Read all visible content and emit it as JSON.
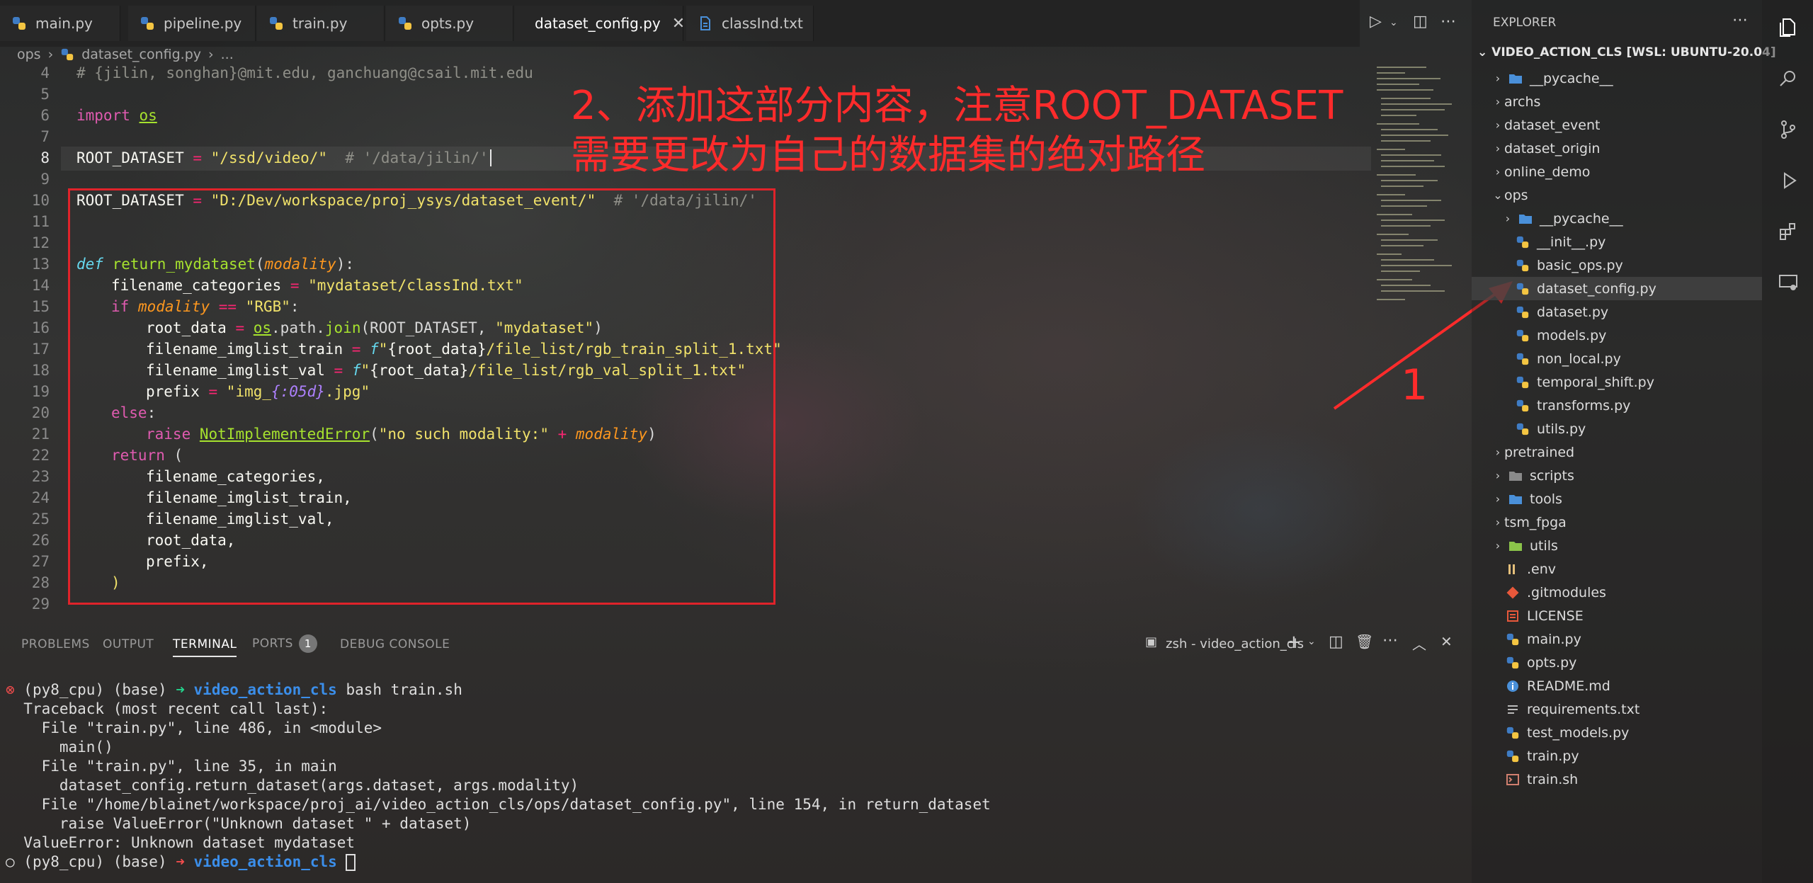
{
  "tabs": [
    {
      "label": "main.py",
      "icon": "python-icon"
    },
    {
      "label": "pipeline.py",
      "icon": "python-icon"
    },
    {
      "label": "train.py",
      "icon": "python-icon"
    },
    {
      "label": "opts.py",
      "icon": "python-icon"
    },
    {
      "label": "dataset_config.py",
      "icon": "python-icon",
      "active": true
    },
    {
      "label": "classInd.txt",
      "icon": "text-file-icon"
    }
  ],
  "breadcrumb": {
    "folder": "ops",
    "file": "dataset_config.py",
    "more": "..."
  },
  "editor": {
    "line_numbers": [
      "4",
      "5",
      "6",
      "7",
      "8",
      "9",
      "10",
      "11",
      "12",
      "13",
      "14",
      "15",
      "16",
      "17",
      "18",
      "19",
      "20",
      "21",
      "22",
      "23",
      "24",
      "25",
      "26",
      "27",
      "28",
      "29"
    ],
    "code": {
      "l4": "# {jilin, songhan}@mit.edu, ganchuang@csail.mit.edu",
      "l6_kw": "import",
      "l6_mod": "os",
      "l8_var": "ROOT_DATASET",
      "l8_eq": " = ",
      "l8_str": "\"/ssd/video/\"",
      "l8_cm": "  # '/data/jilin/'",
      "l10_var": "ROOT_DATASET",
      "l10_eq": " = ",
      "l10_str": "\"D:/Dev/workspace/proj_ysys/dataset_event/\"",
      "l10_cm": "  # '/data/jilin/'",
      "l13_kw": "def",
      "l13_fn": "return_mydataset",
      "l13_open": "(",
      "l13_pm": "modality",
      "l13_close": "):",
      "l14_var": "filename_categories",
      "l14_eq": " = ",
      "l14_str": "\"mydataset/classInd.txt\"",
      "l15_kw": "if",
      "l15_pm": "modality",
      "l15_op": " == ",
      "l15_str": "\"RGB\"",
      "l15_end": ":",
      "l16_var": "root_data",
      "l16_eq": " = ",
      "l16_mod": "os",
      "l16_mid": ".path.",
      "l16_fn": "join",
      "l16_args": "(ROOT_DATASET, ",
      "l16_str": "\"mydataset\"",
      "l16_end": ")",
      "l17_var": "filename_imglist_train",
      "l17_eq": " = ",
      "l17_f": "f",
      "l17_str1": "\"",
      "l17_expr": "{root_data}",
      "l17_str2": "/file_list/rgb_train_split_1.txt\"",
      "l18_var": "filename_imglist_val",
      "l18_eq": " = ",
      "l18_f": "f",
      "l18_str1": "\"",
      "l18_expr": "{root_data}",
      "l18_str2": "/file_list/rgb_val_split_1.txt\"",
      "l19_var": "prefix",
      "l19_eq": " = ",
      "l19_str1": "\"img_",
      "l19_fmt": "{:05d}",
      "l19_str2": ".jpg\"",
      "l20_kw": "else",
      "l20_end": ":",
      "l21_kw": "raise",
      "l21_cls": "NotImplementedError",
      "l21_open": "(",
      "l21_str": "\"no such modality:\"",
      "l21_op": " + ",
      "l21_pm": "modality",
      "l21_close": ")",
      "l22_kw": "return",
      "l22_open": " (",
      "l23": "filename_categories,",
      "l24": "filename_imglist_train,",
      "l25": "filename_imglist_val,",
      "l26": "root_data,",
      "l27": "prefix,",
      "l28": ")"
    }
  },
  "annotations": {
    "note_line1": "2、添加这部分内容，注意ROOT_DATASET",
    "note_line2": "需要更改为自己的数据集的绝对路径",
    "step_number": "1",
    "color": "#ff2b2b"
  },
  "panel": {
    "tabs": [
      "PROBLEMS",
      "OUTPUT",
      "TERMINAL",
      "PORTS",
      "DEBUG CONSOLE"
    ],
    "active_tab": "TERMINAL",
    "ports_count": "1",
    "terminal_name": "zsh - video_action_cls"
  },
  "terminal": {
    "p1_mark": "⊗",
    "p1_env": " (py8_cpu) (base) ",
    "p1_arrow": "➜ ",
    "p1_dir": "video_action_cls",
    "p1_cmd": " bash train.sh",
    "lines": [
      "  Traceback (most recent call last):",
      "    File \"train.py\", line 486, in <module>",
      "      main()",
      "    File \"train.py\", line 35, in main",
      "      dataset_config.return_dataset(args.dataset, args.modality)",
      "    File \"/home/blainet/workspace/proj_ai/video_action_cls/ops/dataset_config.py\", line 154, in return_dataset",
      "      raise ValueError(\"Unknown dataset \" + dataset)",
      "  ValueError: Unknown dataset mydataset"
    ],
    "p2_mark": "○",
    "p2_env": " (py8_cpu) (base) ",
    "p2_arrow": "➜ ",
    "p2_dir": "video_action_cls"
  },
  "explorer": {
    "title": "EXPLORER",
    "root": "VIDEO_ACTION_CLS [WSL: UBUNTU-20.04]",
    "items": [
      {
        "label": "__pycache__",
        "kind": "folder",
        "icon": "folder-icon"
      },
      {
        "label": "archs",
        "kind": "folder",
        "icon": "folder-icon"
      },
      {
        "label": "dataset_event",
        "kind": "folder",
        "icon": "folder-icon"
      },
      {
        "label": "dataset_origin",
        "kind": "folder",
        "icon": "folder-icon"
      },
      {
        "label": "online_demo",
        "kind": "folder",
        "icon": "folder-icon"
      },
      {
        "label": "ops",
        "kind": "folder-open",
        "icon": "folder-icon"
      },
      {
        "label": "__pycache__",
        "kind": "folder",
        "icon": "folder-icon"
      },
      {
        "label": "__init__.py",
        "kind": "file",
        "icon": "python-icon"
      },
      {
        "label": "basic_ops.py",
        "kind": "file",
        "icon": "python-icon"
      },
      {
        "label": "dataset_config.py",
        "kind": "file",
        "icon": "python-icon",
        "selected": true
      },
      {
        "label": "dataset.py",
        "kind": "file",
        "icon": "python-icon"
      },
      {
        "label": "models.py",
        "kind": "file",
        "icon": "python-icon"
      },
      {
        "label": "non_local.py",
        "kind": "file",
        "icon": "python-icon"
      },
      {
        "label": "temporal_shift.py",
        "kind": "file",
        "icon": "python-icon"
      },
      {
        "label": "transforms.py",
        "kind": "file",
        "icon": "python-icon"
      },
      {
        "label": "utils.py",
        "kind": "file",
        "icon": "python-icon"
      },
      {
        "label": "pretrained",
        "kind": "folder",
        "icon": "folder-icon"
      },
      {
        "label": "scripts",
        "kind": "folder",
        "icon": "folder-icon"
      },
      {
        "label": "tools",
        "kind": "folder",
        "icon": "folder-icon"
      },
      {
        "label": "tsm_fpga",
        "kind": "folder",
        "icon": "folder-icon"
      },
      {
        "label": "utils",
        "kind": "folder",
        "icon": "folder-icon"
      },
      {
        "label": ".env",
        "kind": "file",
        "icon": "settings-file-icon"
      },
      {
        "label": ".gitmodules",
        "kind": "file",
        "icon": "git-icon"
      },
      {
        "label": "LICENSE",
        "kind": "file",
        "icon": "license-icon"
      },
      {
        "label": "main.py",
        "kind": "file",
        "icon": "python-icon"
      },
      {
        "label": "opts.py",
        "kind": "file",
        "icon": "python-icon"
      },
      {
        "label": "README.md",
        "kind": "file",
        "icon": "info-icon"
      },
      {
        "label": "requirements.txt",
        "kind": "file",
        "icon": "text-file-icon"
      },
      {
        "label": "test_models.py",
        "kind": "file",
        "icon": "python-icon"
      },
      {
        "label": "train.py",
        "kind": "file",
        "icon": "python-icon"
      },
      {
        "label": "train.sh",
        "kind": "file",
        "icon": "shell-icon"
      }
    ]
  },
  "colors": {
    "accent_red": "#e0232a",
    "python_blue": "#3f7cc4",
    "python_yellow": "#f4c542",
    "folder_blue": "#4a90d9"
  }
}
